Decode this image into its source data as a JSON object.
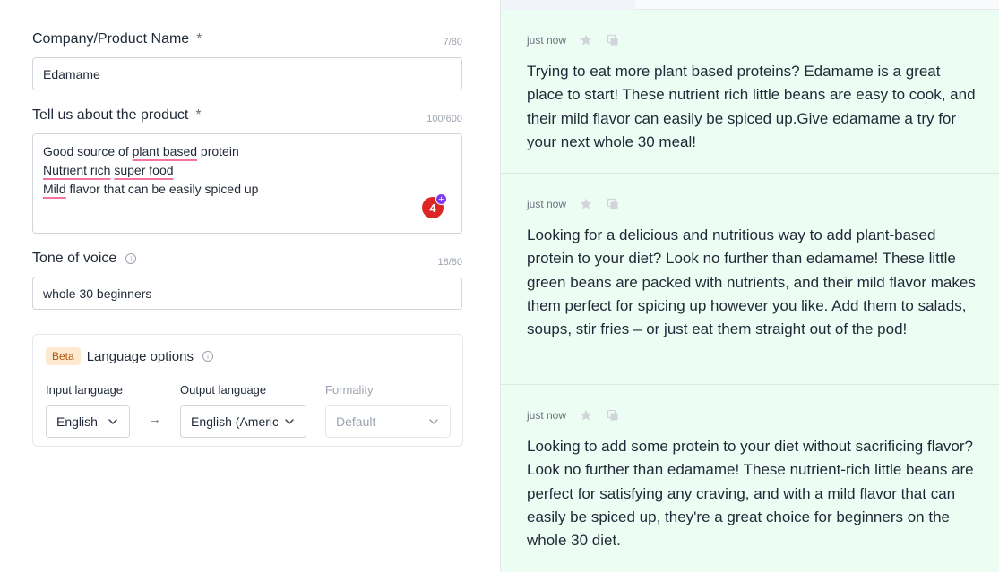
{
  "form": {
    "company": {
      "label": "Company/Product Name",
      "required_mark": "*",
      "counter": "7/80",
      "value": "Edamame"
    },
    "product": {
      "label": "Tell us about the product",
      "required_mark": "*",
      "counter": "100/600",
      "lines": [
        [
          "Good source of ",
          "plant based",
          " protein"
        ],
        [
          "Nutrient rich",
          " ",
          "super food",
          ""
        ],
        [
          "Mild",
          " flavor that can be easily spiced up"
        ]
      ],
      "line1": {
        "a": "Good source of ",
        "b": "plant based",
        "c": " protein"
      },
      "line2": {
        "a": "Nutrient rich",
        "b": " ",
        "c": "super food"
      },
      "line3": {
        "a": "Mild",
        "b": " flavor that can be easily spiced up"
      },
      "badge_count": "4",
      "badge_plus": "+"
    },
    "tone": {
      "label": "Tone of voice",
      "counter": "18/80",
      "value": "whole 30 beginners"
    },
    "language": {
      "beta": "Beta",
      "title": "Language options",
      "input_label": "Input language",
      "input_value": "English",
      "arrow": "→",
      "output_label": "Output language",
      "output_value": "English (American)",
      "formality_label": "Formality",
      "formality_value": "Default"
    }
  },
  "results": [
    {
      "time": "just now",
      "text": "Trying to eat more plant based proteins? Edamame is a great place to start! These nutrient rich little beans are easy to cook, and their mild flavor can easily be spiced up.Give edamame a try for your next whole 30 meal!"
    },
    {
      "time": "just now",
      "text": "Looking for a delicious and nutritious way to add plant-based protein to your diet? Look no further than edamame! These little green beans are packed with nutrients, and their mild flavor makes them perfect for spicing up however you like. Add them to salads, soups, stir fries – or just eat them straight out of the pod!"
    },
    {
      "time": "just now",
      "text": "Looking to add some protein to your diet without sacrificing flavor? Look no further than edamame! These nutrient-rich little beans are perfect for satisfying any craving, and with a mild flavor that can easily be spiced up, they're a great choice for beginners on the whole 30 diet."
    }
  ],
  "colors": {
    "results_bg": "#ecfdf3",
    "badge": "#dc2626",
    "badge_plus": "#7c3aed",
    "beta_bg": "#fde9cf",
    "spell_underline": "#f472a0"
  }
}
